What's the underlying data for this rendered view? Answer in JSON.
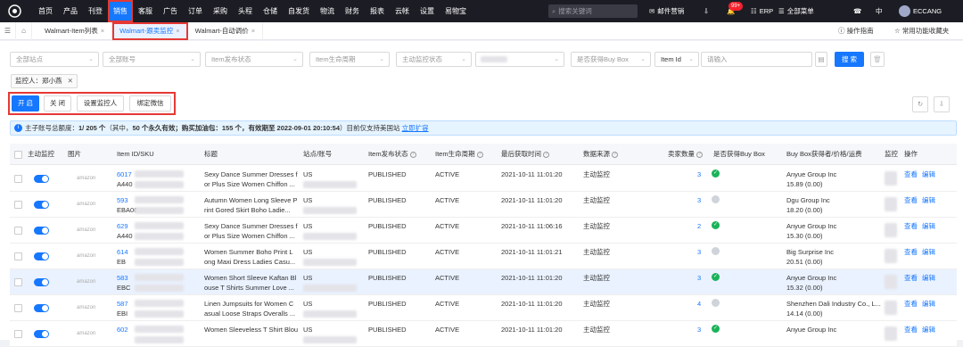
{
  "nav": {
    "items": [
      "首页",
      "产品",
      "刊登",
      "销售",
      "客服",
      "广告",
      "订单",
      "采购",
      "头程",
      "仓储",
      "自发货",
      "物流",
      "财务",
      "报表",
      "云帐",
      "设置",
      "易物宝"
    ],
    "active_index": 3,
    "search_placeholder": "搜索关键词",
    "mail": "邮件营销",
    "badge": "99+",
    "erp": "ERP",
    "menu": "全部菜单",
    "lang": "中",
    "user": "ECCANG"
  },
  "tabs": [
    {
      "label": "Walmart-Item列表",
      "active": false
    },
    {
      "label": "Walmart-跟卖监控",
      "active": true
    },
    {
      "label": "Walmart-自动调价",
      "active": false
    }
  ],
  "tabbar_right": {
    "guide": "操作指南",
    "favorites": "常用功能收藏夹"
  },
  "filters": {
    "site": "全部站点",
    "account": "全部账号",
    "publish_status": "Item发布状态",
    "lifecycle": "Item生命周期",
    "monitor_status": "主动监控状态",
    "buybox": "是否获得Buy Box",
    "item_id": "Item Id",
    "input_placeholder": "请输入",
    "search_btn": "搜 索"
  },
  "monitor_tag": "监控人：郑小燕",
  "actions": {
    "on": "开 启",
    "off": "关 闭",
    "set_person": "设置监控人",
    "bind_wechat": "绑定微信"
  },
  "info": {
    "p1": "主子账号总额度：",
    "quota": "1/ 205 个",
    "p2": "（其中，",
    "perm": "50 个永久有效；购买加油包：",
    "pack": "155 个，有效期至 2022-09-01 20:10:54",
    "p3": "）目前仅支持美国站",
    "link": "立即扩容"
  },
  "table": {
    "headers": [
      "主动监控",
      "图片",
      "Item ID/SKU",
      "标题",
      "站点/账号",
      "Item发布状态",
      "Item生命周期",
      "最后获取时间",
      "数据来源",
      "卖家数量",
      "是否获得Buy Box",
      "Buy Box获得者/价格/运费",
      "监控",
      "操作"
    ],
    "view": "查看",
    "edit": "编辑",
    "rows": [
      {
        "id": "6017",
        "sku": "A440",
        "title1": "Sexy Dance Summer Dresses f",
        "title2": "or Plus Size Women Chiffon ...",
        "site": "US",
        "pub": "PUBLISHED",
        "life": "ACTIVE",
        "time": "2021-10-11 11:01:20",
        "src": "主动监控",
        "sellers": "3",
        "buybox": true,
        "owner": "Anyue Group Inc",
        "price": "15.89  (0.00)",
        "hl": false
      },
      {
        "id": "593",
        "sku": "EBA06",
        "title1": "Autumn Women Long Sleeve P",
        "title2": "rint Gored Skirt Boho Ladie...",
        "site": "US",
        "pub": "PUBLISHED",
        "life": "ACTIVE",
        "time": "2021-10-11 11:01:20",
        "src": "主动监控",
        "sellers": "3",
        "buybox": false,
        "owner": "Dgu Group Inc",
        "price": "18.20  (0.00)",
        "hl": false
      },
      {
        "id": "629",
        "sku": "A440",
        "title1": "Sexy Dance Summer Dresses f",
        "title2": "or Plus Size Women Chiffon ...",
        "site": "US",
        "pub": "PUBLISHED",
        "life": "ACTIVE",
        "time": "2021-10-11 11:06:16",
        "src": "主动监控",
        "sellers": "2",
        "buybox": true,
        "owner": "Anyue Group Inc",
        "price": "15.30  (0.00)",
        "hl": false
      },
      {
        "id": "614",
        "sku": "EB",
        "title1": "Women Summer Boho Print L",
        "title2": "ong Maxi Dress Ladies Casu...",
        "site": "US",
        "pub": "PUBLISHED",
        "life": "ACTIVE",
        "time": "2021-10-11 11:01:21",
        "src": "主动监控",
        "sellers": "3",
        "buybox": false,
        "owner": "Big Surprise Inc",
        "price": "20.51  (0.00)",
        "hl": false
      },
      {
        "id": "583",
        "sku": "EBC",
        "title1": "Women Short Sleeve Kaftan Bl",
        "title2": "ouse T Shirts Summer Love ...",
        "site": "US",
        "pub": "PUBLISHED",
        "life": "ACTIVE",
        "time": "2021-10-11 11:01:20",
        "src": "主动监控",
        "sellers": "3",
        "buybox": true,
        "owner": "Anyue Group Inc",
        "price": "15.32  (0.00)",
        "hl": true
      },
      {
        "id": "587",
        "sku": "EBI",
        "title1": "Linen Jumpsuits for Women C",
        "title2": "asual Loose Straps Overalls ...",
        "site": "US",
        "pub": "PUBLISHED",
        "life": "ACTIVE",
        "time": "2021-10-11 11:01:20",
        "src": "主动监控",
        "sellers": "4",
        "buybox": false,
        "owner": "Shenzhen Dali Industry Co., L...",
        "price": "14.14  (0.00)",
        "hl": false
      },
      {
        "id": "602",
        "sku": "",
        "title1": "Women Sleeveless T Shirt Blou",
        "title2": "",
        "site": "US",
        "pub": "PUBLISHED",
        "life": "ACTIVE",
        "time": "2021-10-11 11:01:20",
        "src": "主动监控",
        "sellers": "3",
        "buybox": true,
        "owner": "Anyue Group Inc",
        "price": "",
        "hl": false
      }
    ]
  }
}
